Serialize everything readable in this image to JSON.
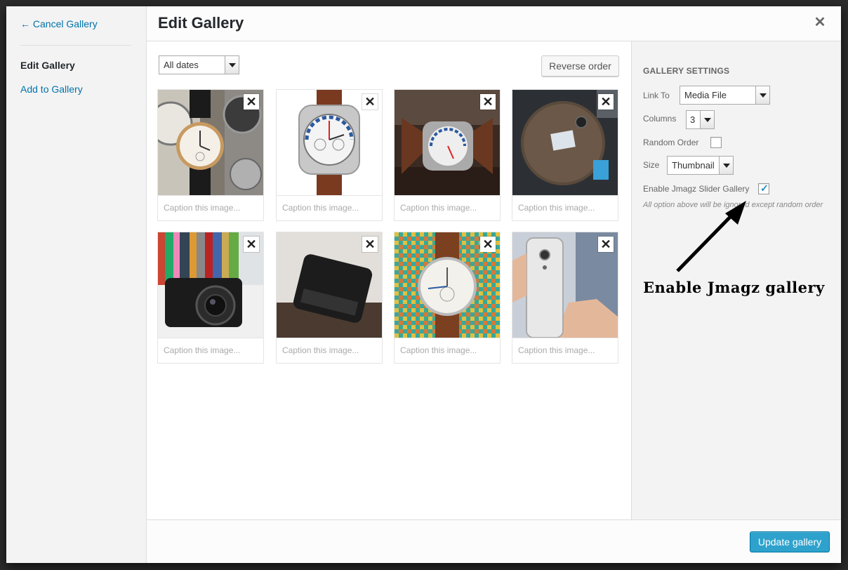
{
  "menu": {
    "cancel_label": "← Cancel Gallery",
    "items": [
      {
        "label": "Edit Gallery"
      },
      {
        "label": "Add to Gallery"
      }
    ]
  },
  "title": "Edit Gallery",
  "toolbar": {
    "date_filter": "All dates",
    "reverse_label": "Reverse order"
  },
  "attachments": [
    {
      "image": "watches-collection",
      "caption_placeholder": "Caption this image..."
    },
    {
      "image": "chronograph-watch",
      "caption_placeholder": "Caption this image..."
    },
    {
      "image": "watch-on-table",
      "caption_placeholder": "Caption this image..."
    },
    {
      "image": "desk-top-view",
      "caption_placeholder": "Caption this image..."
    },
    {
      "image": "sony-camera",
      "caption_placeholder": "Caption this image..."
    },
    {
      "image": "blackberry-phone",
      "caption_placeholder": "Caption this image..."
    },
    {
      "image": "watch-on-fabric",
      "caption_placeholder": "Caption this image..."
    },
    {
      "image": "nexus-phone",
      "caption_placeholder": "Caption this image..."
    }
  ],
  "settings": {
    "heading": "Gallery Settings",
    "link_to_label": "Link To",
    "link_to_value": "Media File",
    "columns_label": "Columns",
    "columns_value": "3",
    "random_order_label": "Random Order",
    "random_order_checked": false,
    "size_label": "Size",
    "size_value": "Thumbnail",
    "jmagz_label": "Enable Jmagz Slider Gallery",
    "jmagz_checked": true,
    "note": "All option above will be ignored except random order"
  },
  "annotation": "Enable Jmagz gallery",
  "footer": {
    "update_label": "Update gallery"
  },
  "colors": {
    "primary": "#2ea2cc",
    "link": "#0073aa"
  }
}
